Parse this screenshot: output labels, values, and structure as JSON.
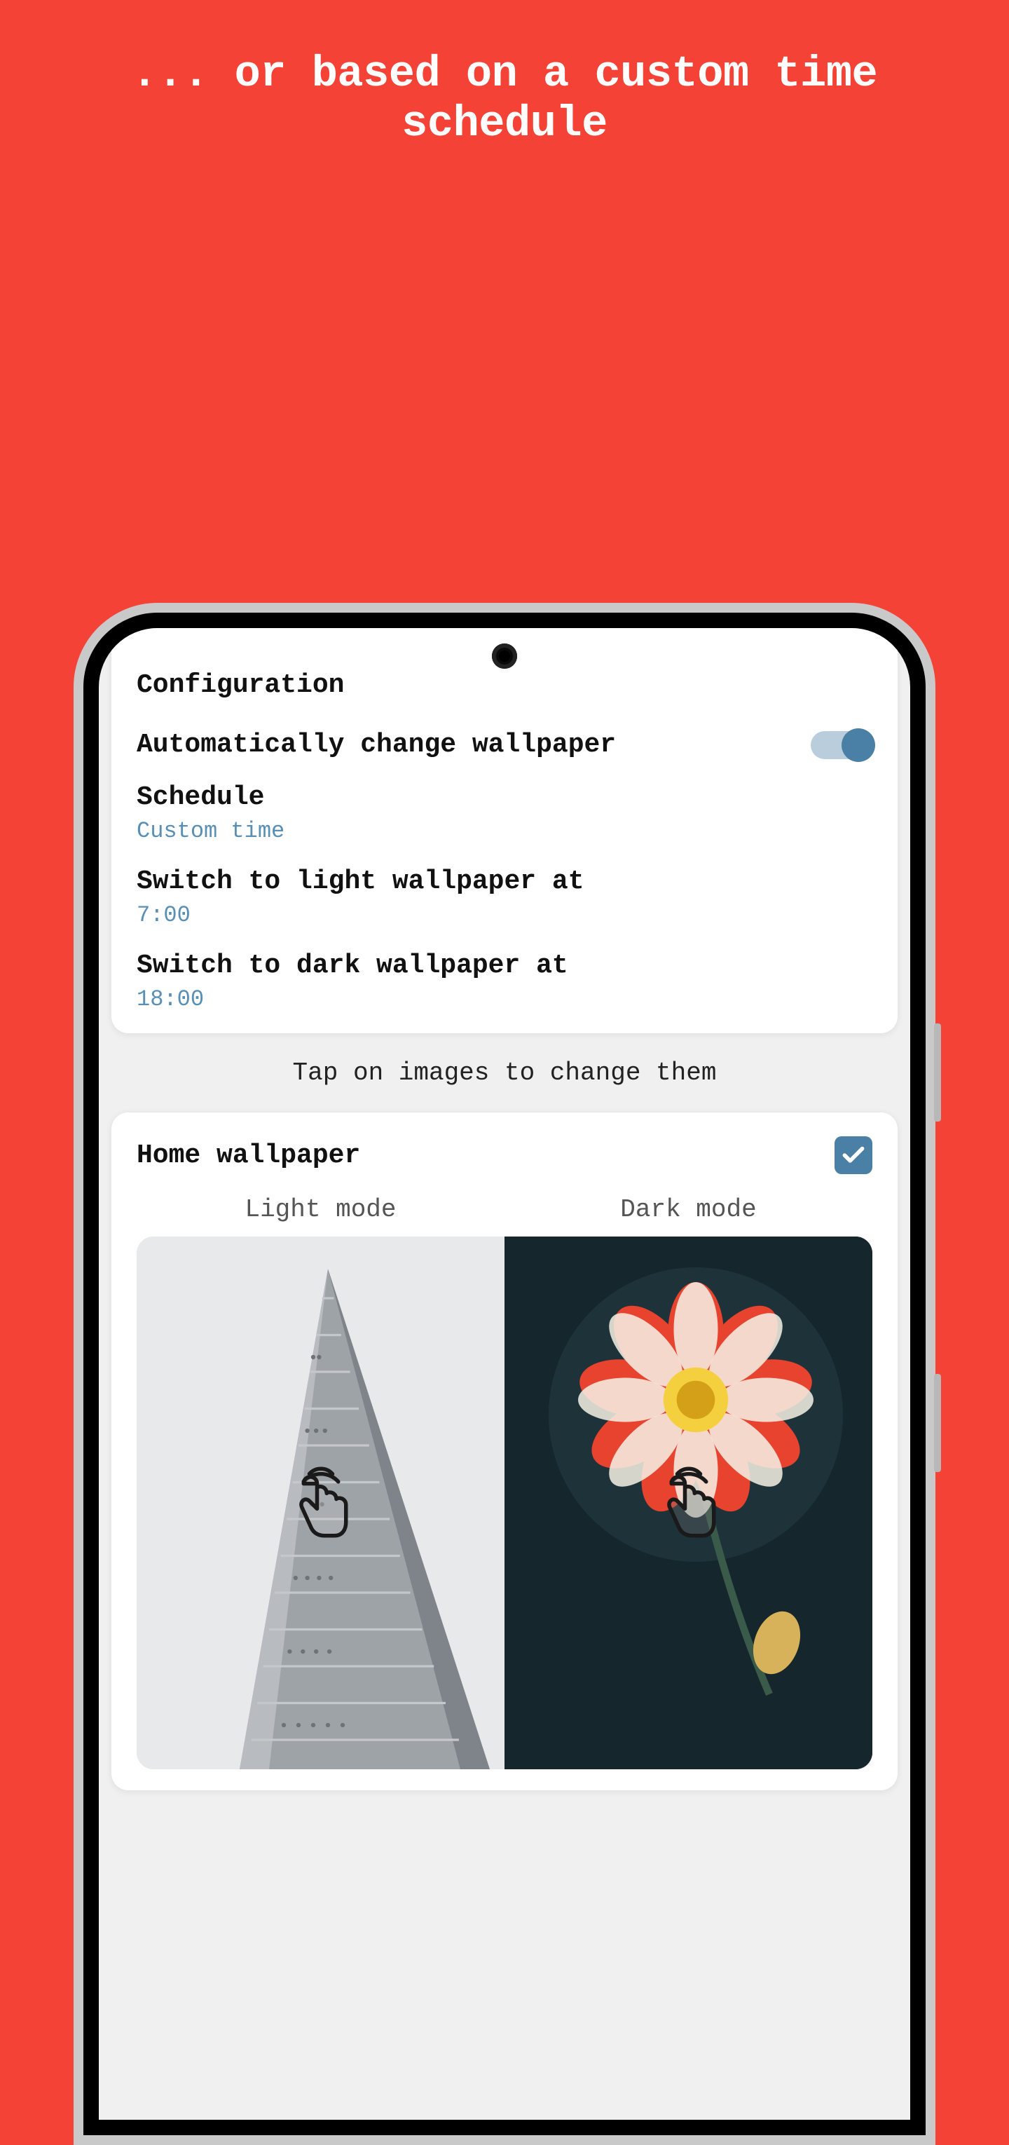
{
  "hero": {
    "text": "... or based on a custom time schedule"
  },
  "config": {
    "title": "Configuration",
    "auto_change_label": "Automatically change wallpaper",
    "auto_change_on": true,
    "schedule_label": "Schedule",
    "schedule_value": "Custom time",
    "light_switch_label": "Switch to light wallpaper at",
    "light_switch_time": "7:00",
    "dark_switch_label": "Switch to dark wallpaper at",
    "dark_switch_time": "18:00"
  },
  "helper": "Tap on images to change them",
  "home": {
    "title": "Home wallpaper",
    "checked": true,
    "light_label": "Light mode",
    "dark_label": "Dark mode"
  }
}
